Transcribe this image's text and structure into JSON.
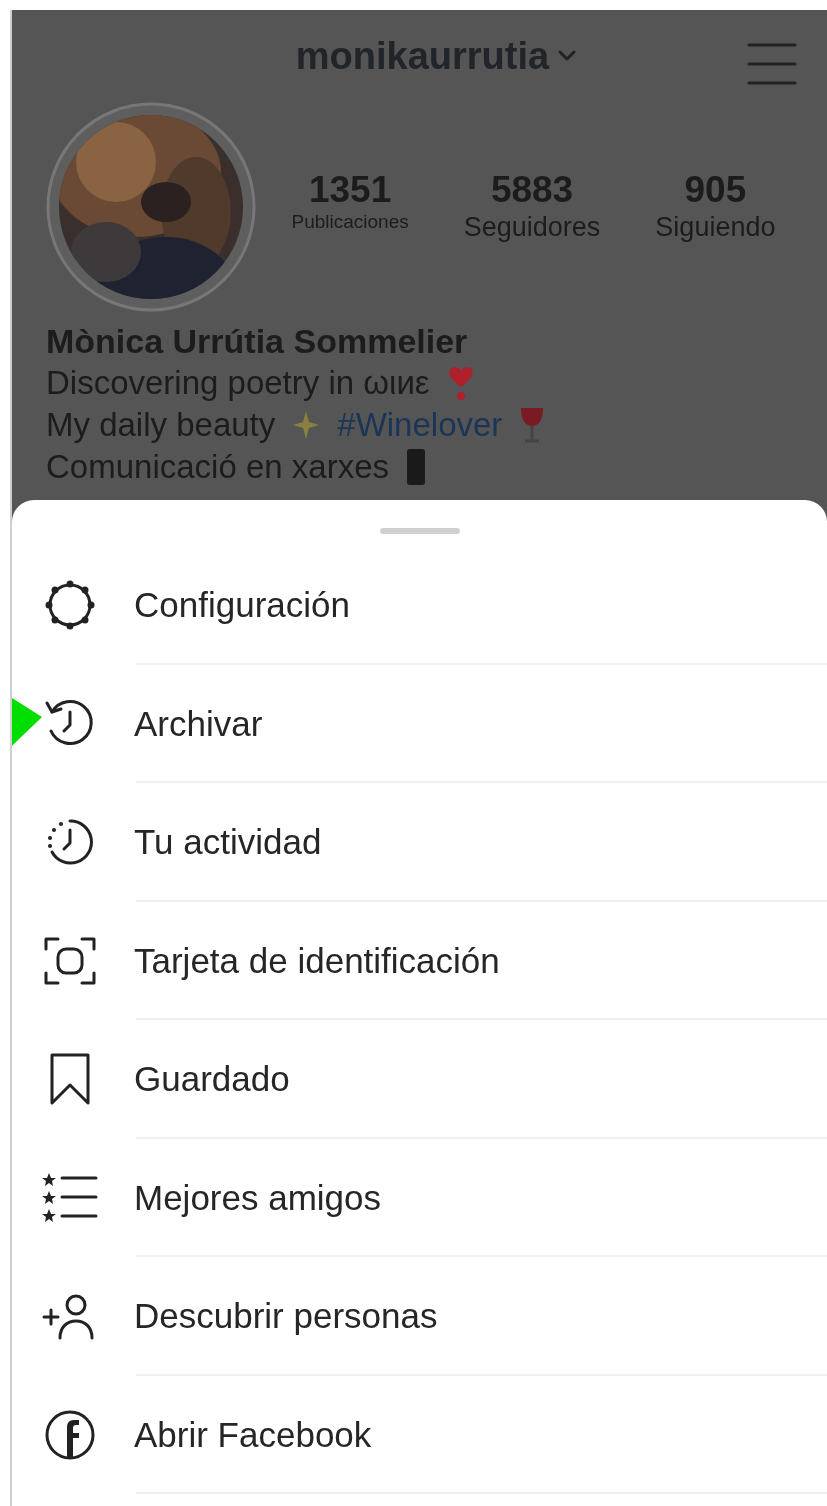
{
  "profile": {
    "username": "monikaurrutia",
    "stats": [
      {
        "value": "1351",
        "label": "Publicaciones",
        "small": true
      },
      {
        "value": "5883",
        "label": "Seguidores",
        "small": false
      },
      {
        "value": "905",
        "label": "Siguiendo",
        "small": false
      }
    ],
    "name": "Mònica Urrútia Sommelier",
    "bio": [
      {
        "text": "Discovering poetry in ωιиε"
      },
      {
        "text": "My daily beauty",
        "hashtag": "#Winelover"
      },
      {
        "text": "Comunicació en xarxes"
      }
    ]
  },
  "menu": [
    {
      "label": "Configuración",
      "pointed": false
    },
    {
      "label": "Archivar",
      "pointed": true
    },
    {
      "label": "Tu actividad",
      "pointed": false
    },
    {
      "label": "Tarjeta de identificación",
      "pointed": false
    },
    {
      "label": "Guardado",
      "pointed": false
    },
    {
      "label": "Mejores amigos",
      "pointed": false
    },
    {
      "label": "Descubrir personas",
      "pointed": false
    },
    {
      "label": "Abrir Facebook",
      "pointed": false
    }
  ]
}
